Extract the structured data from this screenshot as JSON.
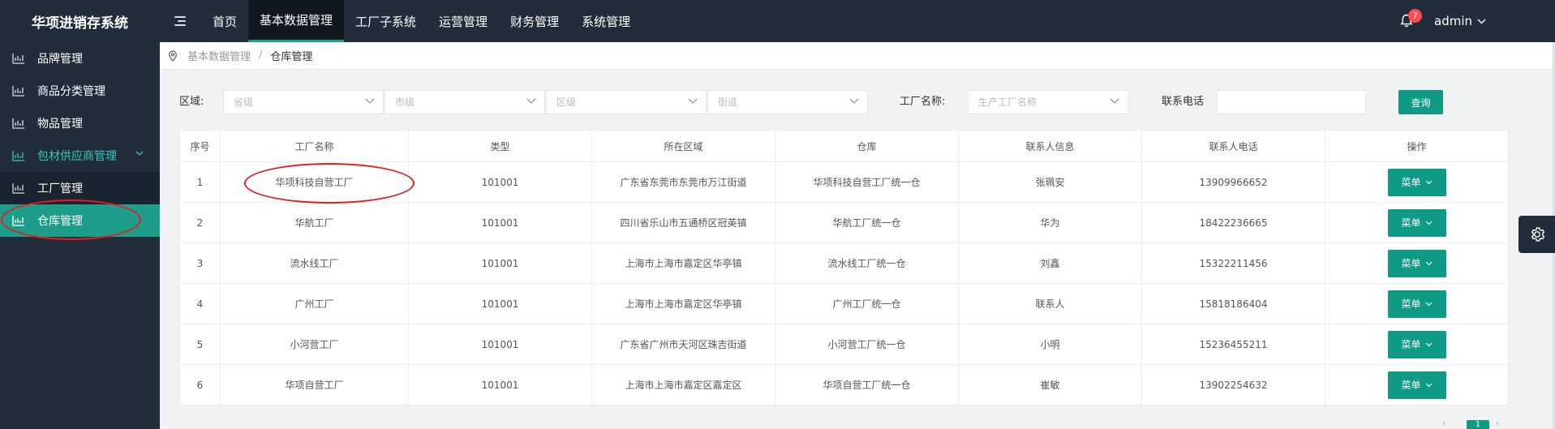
{
  "app": {
    "title": "华项进销存系统"
  },
  "top_nav": [
    {
      "label": "首页",
      "active": false
    },
    {
      "label": "基本数据管理",
      "active": true
    },
    {
      "label": "工厂子系统",
      "active": false
    },
    {
      "label": "运营管理",
      "active": false
    },
    {
      "label": "财务管理",
      "active": false
    },
    {
      "label": "系统管理",
      "active": false
    }
  ],
  "header": {
    "notification_count": "7",
    "username": "admin"
  },
  "sidebar": {
    "items": [
      {
        "label": "品牌管理",
        "icon": "chart-icon"
      },
      {
        "label": "商品分类管理",
        "icon": "chart-icon"
      },
      {
        "label": "物品管理",
        "icon": "chart-icon"
      },
      {
        "label": "包材供应商管理",
        "icon": "chart-icon"
      },
      {
        "label": "工厂管理",
        "icon": "chart-icon"
      },
      {
        "label": "仓库管理",
        "icon": "chart-icon"
      }
    ]
  },
  "breadcrumb": {
    "parent": "基本数据管理",
    "separator": "/",
    "current": "仓库管理"
  },
  "filters": {
    "region_label": "区域:",
    "province_placeholder": "省级",
    "city_placeholder": "市级",
    "district_placeholder": "区级",
    "street_placeholder": "街道",
    "factory_label": "工厂名称:",
    "factory_placeholder": "生产工厂名称",
    "phone_label": "联系电话",
    "phone_value": "",
    "query_label": "查询"
  },
  "table": {
    "columns": [
      "序号",
      "工厂名称",
      "类型",
      "所在区域",
      "仓库",
      "联系人信息",
      "联系人电话",
      "操作"
    ],
    "menu_label": "菜单",
    "rows": [
      {
        "no": "1",
        "name": "华项科技自营工厂",
        "type": "101001",
        "region": "广东省东莞市东莞市万江街道",
        "warehouse": "华项科技自营工厂统一仓",
        "contact": "张珮安",
        "phone": "13909966652"
      },
      {
        "no": "2",
        "name": "华航工厂",
        "type": "101001",
        "region": "四川省乐山市五通桥区冠英镇",
        "warehouse": "华航工厂统一仓",
        "contact": "华为",
        "phone": "18422236665"
      },
      {
        "no": "3",
        "name": "流水线工厂",
        "type": "101001",
        "region": "上海市上海市嘉定区华亭镇",
        "warehouse": "流水线工厂统一仓",
        "contact": "刘鑫",
        "phone": "15322211456"
      },
      {
        "no": "4",
        "name": "广州工厂",
        "type": "101001",
        "region": "上海市上海市嘉定区华亭镇",
        "warehouse": "广州工厂统一仓",
        "contact": "联系人",
        "phone": "15818186404"
      },
      {
        "no": "5",
        "name": "小河营工厂",
        "type": "101001",
        "region": "广东省广州市天河区珠吉街道",
        "warehouse": "小河营工厂统一仓",
        "contact": "小明",
        "phone": "15236455211"
      },
      {
        "no": "6",
        "name": "华项自营工厂",
        "type": "101001",
        "region": "上海市上海市嘉定区嘉定区",
        "warehouse": "华项自营工厂统一仓",
        "contact": "崔敏",
        "phone": "13902254632"
      }
    ]
  },
  "pagination": {
    "current_page": "1"
  },
  "colors": {
    "header_bg": "#222d3c",
    "accent": "#0e9a84",
    "active_sidebar": "#1e9e8a",
    "annotation": "#e02020"
  }
}
